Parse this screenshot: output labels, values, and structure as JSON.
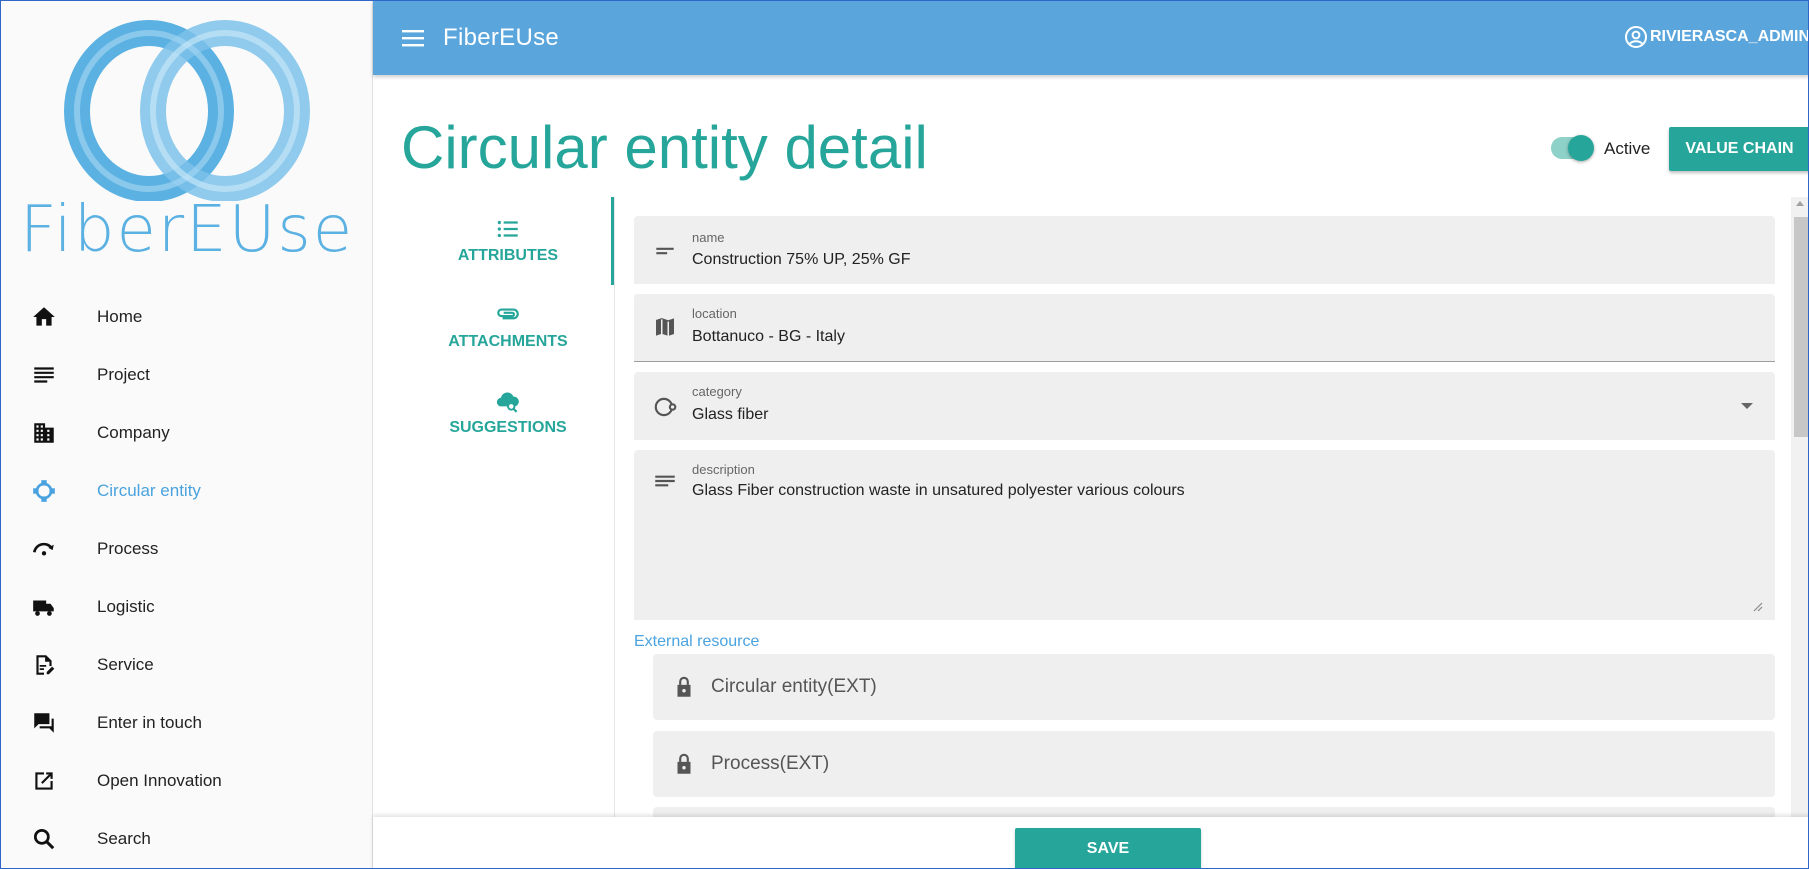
{
  "sidebar": {
    "logo_text": "FiberEUse",
    "items": [
      {
        "label": "Home",
        "icon": "home-icon"
      },
      {
        "label": "Project",
        "icon": "list-icon"
      },
      {
        "label": "Company",
        "icon": "building-icon"
      },
      {
        "label": "Circular entity",
        "icon": "circular-entity-icon",
        "active": true
      },
      {
        "label": "Process",
        "icon": "process-icon"
      },
      {
        "label": "Logistic",
        "icon": "truck-icon"
      },
      {
        "label": "Service",
        "icon": "service-icon"
      },
      {
        "label": "Enter in touch",
        "icon": "chat-icon"
      },
      {
        "label": "Open Innovation",
        "icon": "open-external-icon"
      },
      {
        "label": "Search",
        "icon": "search-icon"
      }
    ]
  },
  "topbar": {
    "app_title": "FiberEUse",
    "user": "RIVIERASCA_ADMIN"
  },
  "page": {
    "title": "Circular entity detail",
    "active_label": "Active",
    "value_chain_label": "VALUE CHAIN"
  },
  "tabs": [
    {
      "label": "ATTRIBUTES",
      "icon": "list-bullet-icon"
    },
    {
      "label": "ATTACHMENTS",
      "icon": "paperclip-icon"
    },
    {
      "label": "SUGGESTIONS",
      "icon": "cloud-search-icon"
    }
  ],
  "form": {
    "name": {
      "label": "name",
      "value": "Construction 75% UP, 25% GF"
    },
    "location": {
      "label": "location",
      "value": "Bottanuco - BG - Italy"
    },
    "category": {
      "label": "category",
      "value": "Glass fiber"
    },
    "description": {
      "label": "description",
      "value": "Glass Fiber construction waste in unsatured polyester various colours"
    },
    "external_resource_label": "External resource",
    "external": [
      "Circular entity(EXT)",
      "Process(EXT)"
    ]
  },
  "footer": {
    "save_label": "SAVE"
  },
  "colors": {
    "topbar": "#5aa6dc",
    "accent": "#26a69a",
    "link": "#4aa3df"
  }
}
